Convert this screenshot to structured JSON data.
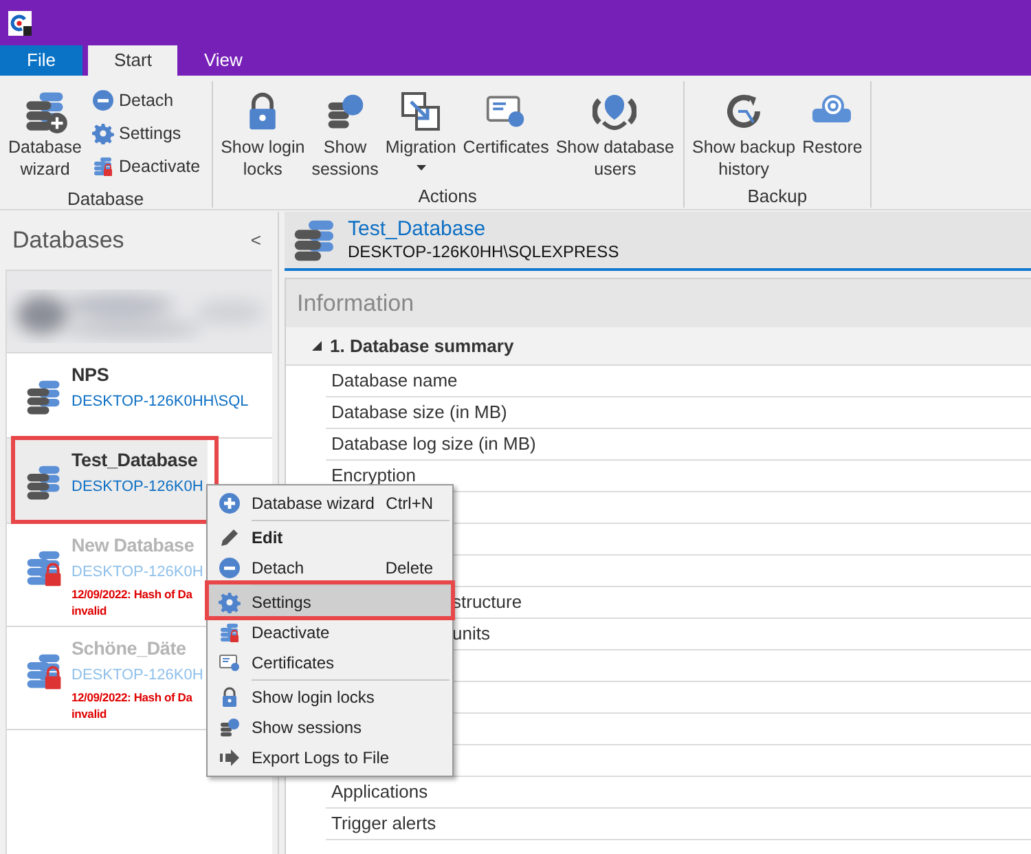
{
  "tabs": [
    {
      "label": "File",
      "kind": "file",
      "selected": false
    },
    {
      "label": "Start",
      "kind": "tab",
      "selected": true
    },
    {
      "label": "View",
      "kind": "tab",
      "selected": false
    }
  ],
  "ribbon": {
    "groups": [
      {
        "label": "Database",
        "buttons": [
          {
            "kind": "large",
            "lines": [
              "Database",
              "wizard"
            ]
          },
          {
            "kind": "small",
            "lines": [
              "Detach"
            ]
          },
          {
            "kind": "small",
            "lines": [
              "Settings"
            ]
          },
          {
            "kind": "small",
            "lines": [
              "Deactivate"
            ]
          }
        ]
      },
      {
        "label": "Actions",
        "buttons": [
          {
            "kind": "large",
            "lines": [
              "Show login",
              "locks"
            ]
          },
          {
            "kind": "large",
            "lines": [
              "Show",
              "sessions"
            ]
          },
          {
            "kind": "dropdown",
            "lines": [
              "Migration"
            ]
          },
          {
            "kind": "large",
            "lines": [
              "Certificates"
            ]
          },
          {
            "kind": "large",
            "lines": [
              "Show database",
              "users"
            ]
          }
        ]
      },
      {
        "label": "Backup",
        "buttons": [
          {
            "kind": "large",
            "lines": [
              "Show backup",
              "history"
            ]
          },
          {
            "kind": "large",
            "lines": [
              "Restore"
            ]
          }
        ]
      }
    ]
  },
  "sidebar": {
    "title": "Databases",
    "collapse": "<",
    "items": [
      {
        "kind": "picture"
      },
      {
        "kind": "database",
        "name": "NPS",
        "server": "DESKTOP-126K0HH\\SQL",
        "disabled": false,
        "selected": false,
        "highlighted": false
      },
      {
        "kind": "database",
        "name": "Test_Database",
        "server": "DESKTOP-126K0H",
        "disabled": false,
        "selected": true,
        "highlighted": true
      },
      {
        "kind": "database",
        "name": "New Database",
        "server": "DESKTOP-126K0H",
        "disabled": true,
        "selected": false,
        "highlighted": false,
        "error": [
          "12/09/2022: Hash of Da",
          "invalid"
        ]
      },
      {
        "kind": "database",
        "name": "Schöne_Däte",
        "server": "DESKTOP-126K0H",
        "disabled": true,
        "selected": false,
        "highlighted": false,
        "error": [
          "12/09/2022: Hash of Da",
          "invalid"
        ]
      }
    ]
  },
  "header": {
    "name": "Test_Database",
    "server": "DESKTOP-126K0HH\\SQLEXPRESS"
  },
  "information": {
    "title": "Information",
    "section": {
      "label": "1. Database summary",
      "expanded": true
    },
    "rows": [
      {
        "kind": "text",
        "label": "Database name"
      },
      {
        "kind": "text",
        "label": "Database size (in MB)"
      },
      {
        "kind": "text",
        "label": "Database log size (in MB)"
      },
      {
        "kind": "text",
        "label": "Encryption"
      },
      {
        "kind": "covered"
      },
      {
        "kind": "covered"
      },
      {
        "kind": "covered"
      },
      {
        "kind": "partial",
        "label": "structure"
      },
      {
        "kind": "partial",
        "label": "units"
      },
      {
        "kind": "covered"
      },
      {
        "kind": "covered"
      },
      {
        "kind": "covered"
      },
      {
        "kind": "covered"
      },
      {
        "kind": "text",
        "label": "Applications"
      },
      {
        "kind": "text",
        "label": "Trigger alerts"
      }
    ]
  },
  "context_menu": {
    "items": [
      {
        "label": "Database wizard",
        "shortcut": "Ctrl+N",
        "bold": false,
        "selected": false,
        "highlighted": false,
        "separator_before": false
      },
      {
        "label": "Edit",
        "bold": true,
        "selected": false,
        "highlighted": false,
        "separator_before": true
      },
      {
        "label": "Detach",
        "shortcut": "Delete",
        "bold": false,
        "selected": false,
        "highlighted": false,
        "separator_before": false
      },
      {
        "label": "Settings",
        "bold": false,
        "selected": true,
        "highlighted": true,
        "separator_before": true
      },
      {
        "label": "Deactivate",
        "bold": false,
        "selected": false,
        "highlighted": false,
        "separator_before": false
      },
      {
        "label": "Certificates",
        "bold": false,
        "selected": false,
        "highlighted": false,
        "separator_before": false
      },
      {
        "label": "Show login locks",
        "bold": false,
        "selected": false,
        "highlighted": false,
        "separator_before": true
      },
      {
        "label": "Show sessions",
        "bold": false,
        "selected": false,
        "highlighted": false,
        "separator_before": false
      },
      {
        "label": "Export Logs to File",
        "bold": false,
        "selected": false,
        "highlighted": false,
        "separator_before": false
      }
    ]
  }
}
